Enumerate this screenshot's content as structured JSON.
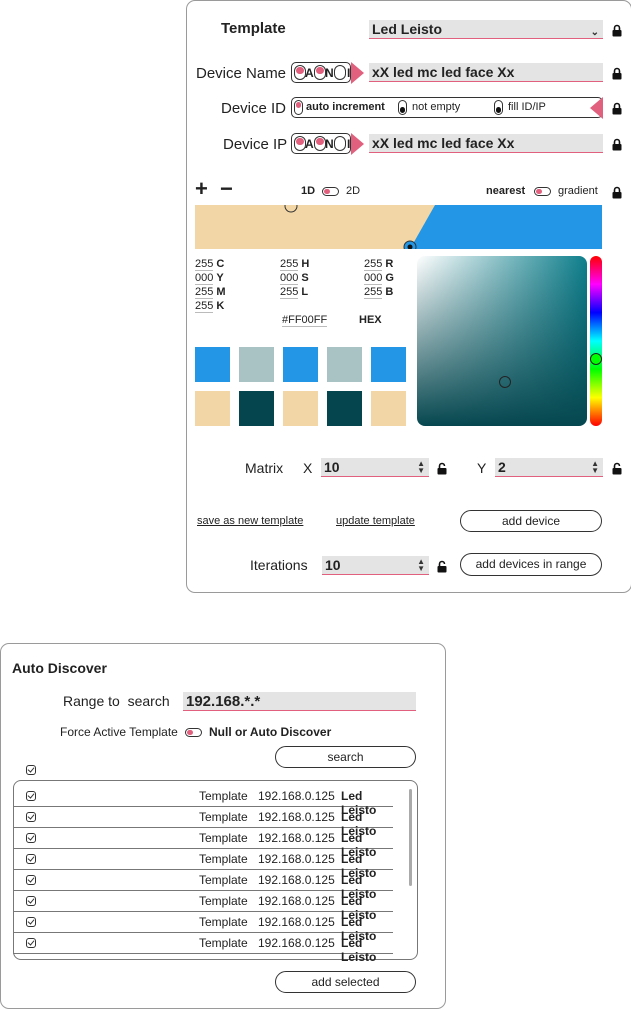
{
  "device_editor": {
    "template_label": "Template",
    "template_value": "Led Leisto",
    "device_name_label": "Device Name",
    "device_name_value": "xX led mc led face Xx",
    "device_id_label": "Device ID",
    "device_id_options": [
      "auto increment",
      "not empty",
      "fill ID/IP"
    ],
    "device_ip_label": "Device IP",
    "device_ip_value": "xX led mc led face Xx",
    "pill_letters": [
      "A",
      "N",
      "I"
    ],
    "plus": "+",
    "minus": "−",
    "mode_1d": "1D",
    "mode_2d": "2D",
    "interp_nearest": "nearest",
    "interp_gradient": "gradient",
    "color_values": {
      "C": "255",
      "Y": "000",
      "M": "255",
      "K": "255",
      "H": "255",
      "S": "000",
      "L": "255",
      "R": "255",
      "G": "000",
      "B": "255"
    },
    "hex_value": "#FF00FF",
    "hex_label": "HEX",
    "gradient_colors": [
      "#f2d6a5",
      "#2396e5"
    ],
    "picker_color": "#06474f",
    "swatches_row1": [
      "#2396e5",
      "#a9c3c4",
      "#2396e5",
      "#a9c3c4",
      "#2396e5"
    ],
    "swatches_row2": [
      "#f2d6a5",
      "#05454d",
      "#f2d6a5",
      "#05454d",
      "#f2d6a5"
    ],
    "matrix_label": "Matrix",
    "x_label": "X",
    "x_value": "10",
    "y_label": "Y",
    "y_value": "2",
    "save_new_template": "save as new template",
    "update_template": "update template",
    "add_device": "add device",
    "iterations_label": "Iterations",
    "iterations_value": "10",
    "add_devices_range": "add devices in range",
    "accent_color": "#e0607e"
  },
  "auto_discover": {
    "title": "Auto Discover",
    "range_label": "Range to  search",
    "range_value": "192.168.*.*",
    "force_label": "Force Active Template",
    "force_value": "Null or Auto Discover",
    "search_button": "search",
    "rows": [
      {
        "template": "Template",
        "ip": "192.168.0.125",
        "name": "Led Leisto"
      },
      {
        "template": "Template",
        "ip": "192.168.0.125",
        "name": "Led Leisto"
      },
      {
        "template": "Template",
        "ip": "192.168.0.125",
        "name": "Led Leisto"
      },
      {
        "template": "Template",
        "ip": "192.168.0.125",
        "name": "Led Leisto"
      },
      {
        "template": "Template",
        "ip": "192.168.0.125",
        "name": "Led Leisto"
      },
      {
        "template": "Template",
        "ip": "192.168.0.125",
        "name": "Led Leisto"
      },
      {
        "template": "Template",
        "ip": "192.168.0.125",
        "name": "Led Leisto"
      },
      {
        "template": "Template",
        "ip": "192.168.0.125",
        "name": "Led Leisto"
      }
    ],
    "add_selected": "add selected"
  }
}
